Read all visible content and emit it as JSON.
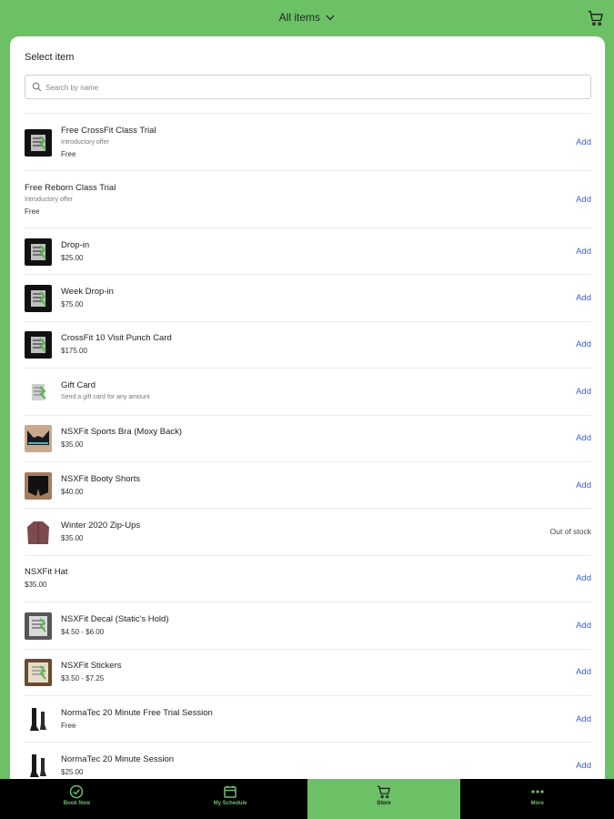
{
  "header": {
    "filter_label": "All items"
  },
  "card": {
    "title": "Select item",
    "search_placeholder": "Search by name"
  },
  "items": [
    {
      "name": "Free CrossFit Class Trial",
      "subtitle": "Introductory offer",
      "price": "Free",
      "action": "Add",
      "thumb": "logo-dark"
    },
    {
      "name": "Free Reborn Class Trial",
      "subtitle": "Introductory offer",
      "price": "Free",
      "action": "Add",
      "thumb": "none"
    },
    {
      "name": "Drop-in",
      "subtitle": "",
      "price": "$25.00",
      "action": "Add",
      "thumb": "logo-dark"
    },
    {
      "name": "Week Drop-in",
      "subtitle": "",
      "price": "$75.00",
      "action": "Add",
      "thumb": "logo-dark"
    },
    {
      "name": "CrossFit 10 Visit Punch Card",
      "subtitle": "",
      "price": "$175.00",
      "action": "Add",
      "thumb": "logo-dark"
    },
    {
      "name": "Gift Card",
      "subtitle": "Send a gift card for any amount",
      "price": "",
      "action": "Add",
      "thumb": "logo-light"
    },
    {
      "name": "NSXFit Sports Bra (Moxy Back)",
      "subtitle": "",
      "price": "$35.00",
      "action": "Add",
      "thumb": "bra"
    },
    {
      "name": "NSXFit Booty Shorts",
      "subtitle": "",
      "price": "$40.00",
      "action": "Add",
      "thumb": "shorts"
    },
    {
      "name": "Winter 2020 Zip-Ups",
      "subtitle": "",
      "price": "$35.00",
      "action": "Out of stock",
      "thumb": "hoodie"
    },
    {
      "name": "NSXFit Hat",
      "subtitle": "",
      "price": "$35.00",
      "action": "Add",
      "thumb": "none"
    },
    {
      "name": "NSXFit Decal (Static's Hold)",
      "subtitle": "",
      "price": "$4.50 - $6.00",
      "action": "Add",
      "thumb": "decal"
    },
    {
      "name": "NSXFit Stickers",
      "subtitle": "",
      "price": "$3.50 - $7.25",
      "action": "Add",
      "thumb": "sticker"
    },
    {
      "name": "NormaTec 20 Minute Free Trial Session",
      "subtitle": "",
      "price": "Free",
      "action": "Add",
      "thumb": "boots"
    },
    {
      "name": "NormaTec 20 Minute Session",
      "subtitle": "",
      "price": "$25.00",
      "action": "Add",
      "thumb": "boots"
    }
  ],
  "nav": [
    {
      "label": "Book Now",
      "icon": "check-circle-icon",
      "active": false
    },
    {
      "label": "My Schedule",
      "icon": "calendar-icon",
      "active": false
    },
    {
      "label": "Store",
      "icon": "cart-icon",
      "active": true
    },
    {
      "label": "More",
      "icon": "more-dots-icon",
      "active": false
    }
  ],
  "colors": {
    "brand_green": "#6cc066",
    "link_blue": "#3a5fd6",
    "nav_bg": "#000000"
  }
}
